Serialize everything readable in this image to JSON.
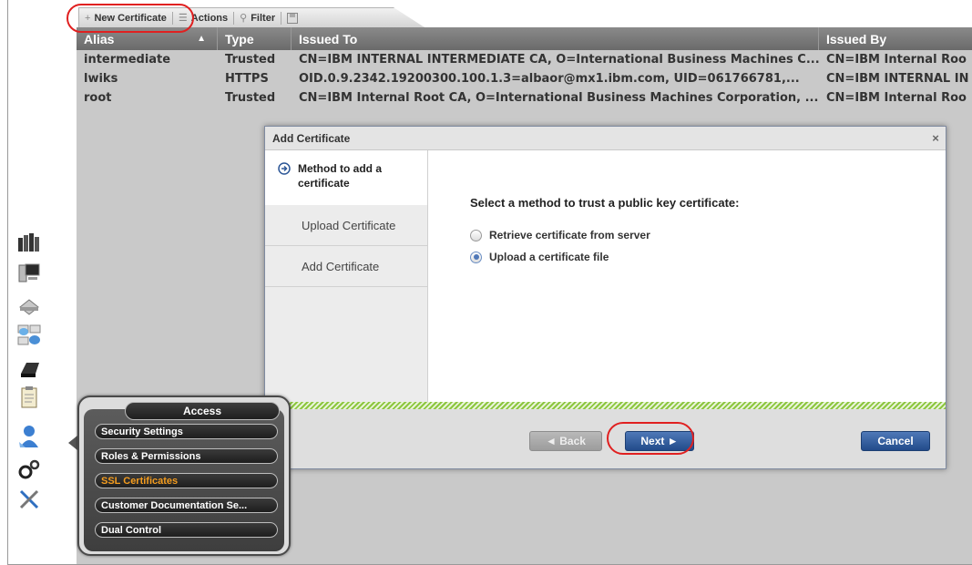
{
  "toolbar": {
    "new_certificate": "New Certificate",
    "actions": "Actions",
    "filter": "Filter"
  },
  "table": {
    "columns": [
      "Alias",
      "Type",
      "Issued To",
      "Issued By"
    ],
    "sort_column": "Alias",
    "rows": [
      {
        "alias": "intermediate",
        "type": "Trusted",
        "issued_to": "CN=IBM INTERNAL INTERMEDIATE CA, O=International Business Machines C...",
        "issued_by": "CN=IBM Internal Roo"
      },
      {
        "alias": "lwiks",
        "type": "HTTPS",
        "issued_to": "OID.0.9.2342.19200300.100.1.3=albaor@mx1.ibm.com, UID=061766781,...",
        "issued_by": "CN=IBM INTERNAL IN"
      },
      {
        "alias": "root",
        "type": "Trusted",
        "issued_to": "CN=IBM Internal Root CA, O=International Business Machines Corporation, ...",
        "issued_by": "CN=IBM Internal Roo"
      }
    ]
  },
  "dialog": {
    "title": "Add Certificate",
    "close": "×",
    "steps": {
      "current": "Method to add a certificate",
      "items": [
        "Upload Certificate",
        "Add Certificate"
      ]
    },
    "prompt": "Select a method to trust a public key certificate:",
    "options": [
      {
        "label": "Retrieve certificate from server",
        "selected": false
      },
      {
        "label": "Upload a certificate file",
        "selected": true
      }
    ],
    "back": "◄ Back",
    "next": "Next ►",
    "cancel": "Cancel"
  },
  "access_menu": {
    "title": "Access",
    "items": [
      "Security Settings",
      "Roles & Permissions",
      "SSL Certificates",
      "Customer Documentation Se...",
      "Dual Control"
    ],
    "active_item": "SSL Certificates"
  },
  "colors": {
    "accent_blue": "#2d5797",
    "highlight_red": "#e02020",
    "active_menu": "#f39c1f",
    "progress_green": "#8dc63f"
  },
  "nav_icons": [
    "cluster-icon",
    "monitor-icon",
    "storage-icon",
    "network-icon",
    "drive-icon",
    "clipboard-icon",
    "user-icon",
    "gears-icon",
    "tools-icon"
  ]
}
